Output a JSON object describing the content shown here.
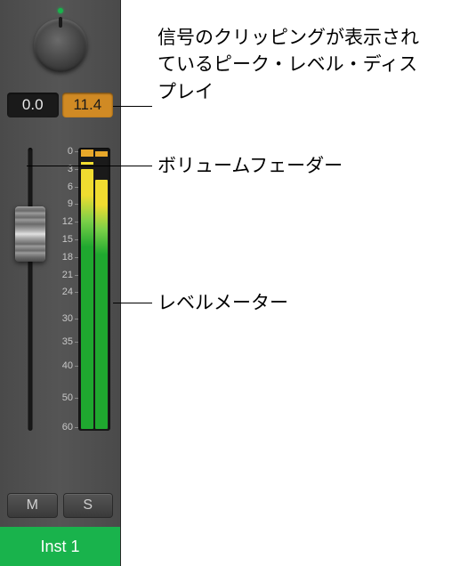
{
  "peak": {
    "left": "0.0",
    "right": "11.4"
  },
  "buttons": {
    "mute": "M",
    "solo": "S"
  },
  "track_name": "Inst 1",
  "scale_labels": [
    "0",
    "3",
    "6",
    "9",
    "12",
    "15",
    "18",
    "21",
    "24",
    "30",
    "35",
    "40",
    "50",
    "60"
  ],
  "callouts": {
    "peak": "信号のクリッピングが表示されているピーク・レベル・ディスプレイ",
    "fader": "ボリュームフェーダー",
    "meter": "レベルメーター"
  },
  "meter": {
    "left_db": 0.0,
    "right_db": -2.0,
    "peak_left_db": 11.4,
    "clip_left": true,
    "clip_right": true
  },
  "scale_pct": [
    3,
    9,
    15,
    21,
    27,
    33,
    39,
    45,
    51,
    60,
    68,
    76,
    87,
    97
  ]
}
